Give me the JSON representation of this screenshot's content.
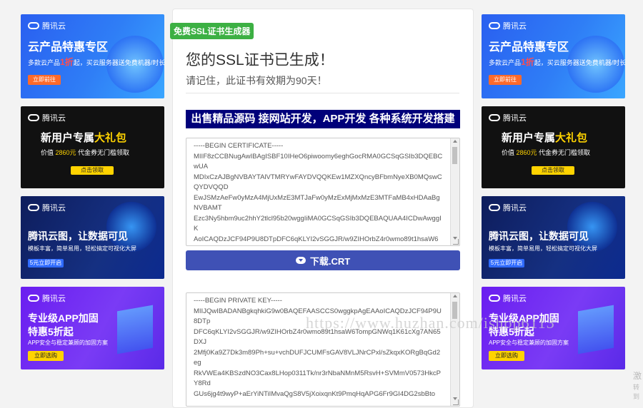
{
  "tag": "免费SSL证书生成器",
  "heading": "您的SSL证书已生成！",
  "subheading": "请记住，此证书有效期为90天！",
  "banner": "出售精品源码 接网站开发，APP开发 各种系统开发搭建",
  "certificate_text": "-----BEGIN CERTIFICATE-----\nMIIF8zCCBNugAwIBAgISBF10IHeO6piwoomy6eghGocRMA0GCSqGSIb3DQEBCwUA\nMDIxCzAJBgNVBAYTAlVTMRYwFAYDVQQKEw1MZXQncyBFbmNyeXB0MQswCQYDVQQD\nEwJSMzAeFw0yMzA4MjUxMzE3MTJaFw0yMzExMjMxMzE3MTFaMB4xHDAaBgNVBAMT\nEzc3Ny5hbm9uc2hhY2tlcl95b20wggIiMA0GCSqGSIb3DQEBAQUAA4ICDwAwggIK\nAoICAQDzJCF94P9U8DTpDFC6qKLYI2vSGGJR/w9ZIHOrbZ4r0wmo89t1hsaW6",
  "download_crt_label": "下载.CRT",
  "private_key_text": "-----BEGIN PRIVATE KEY-----\nMIIJQwIBADANBgkqhkiG9w0BAQEFAASCCS0wggkpAgEAAoICAQDzJCF94P9U8DTp\nDFC6qKLYI2vSGGJR/w9ZIHOrbZ4r0wmo89t1hsaW6TompGNWq1K61cXg7AN65DXJ\n2Mfj0Ka9Z7Dk3m89Ph+su+vchDUFJCUMFsGAV8VLJNrCPxl/sZkqxKORgBqGd2eg\nRkVWEa4KBSzdNO3Cax8LHop0311Tk/nr3rNbaNMnM5RsvH+SVMmV0573HkcPY8Rd\nGUs6jg4t9wyP+aErYiNTiIMvaQgS8V5jXoixqnKt9PmqHqAPG6Fr9GI4DG2sbBto",
  "watermark": "https://www.huzhan.com/ishop6113",
  "side_text_1": "激",
  "side_text_2": "转到",
  "ads_left": [
    {
      "logo": "腾讯云",
      "title": "云产品特惠专区",
      "sub_pre": "多款云产品",
      "sub_hl": "1折",
      "sub_post": "起，买云服务器送免费机器/时长",
      "btn": "立即前往"
    },
    {
      "logo": "腾讯云",
      "title_pre": "新用户专属",
      "title_hl": "大礼包",
      "sub_pre": "价值 ",
      "sub_hl": "2860元",
      "sub_post": " 代金券无门槛领取",
      "btn": "点击领取"
    },
    {
      "logo": "腾讯云",
      "title": "腾讯云图，让数据可见",
      "sub": "模板丰富，简单易用，轻松搞定可视化大屏",
      "btn": "5元立即开启"
    },
    {
      "logo": "腾讯云",
      "title": "专业级APP加固",
      "title2": "特惠5折起",
      "sub": "APP安全与稳定兼顾的加固方案",
      "btn": "立即选购"
    }
  ],
  "ads_right": [
    {
      "logo": "腾讯云",
      "title": "云产品特惠专区",
      "sub_pre": "多款云产品",
      "sub_hl": "1折",
      "sub_post": "起，买云服务器送免费机器/时长",
      "btn": "立即前往"
    },
    {
      "logo": "腾讯云",
      "title_pre": "新用户专属",
      "title_hl": "大礼包",
      "sub_pre": "价值 ",
      "sub_hl": "2860元",
      "sub_post": " 代金券无门槛领取",
      "btn": "点击领取"
    },
    {
      "logo": "腾讯云",
      "title": "腾讯云图，让数据可见",
      "sub": "模板丰富，简单易用，轻松搞定可视化大屏",
      "btn": "5元立即开启"
    },
    {
      "logo": "腾讯云",
      "title": "专业级APP加固",
      "title2": "特惠5折起",
      "sub": "APP安全与稳定兼顾的加固方案",
      "btn": "立即选购"
    }
  ],
  "colors": {
    "tag_bg": "#3cb043",
    "banner_bg": "#00007a",
    "button_bg": "#3f51b5",
    "ad_accent": "#ffd300"
  }
}
